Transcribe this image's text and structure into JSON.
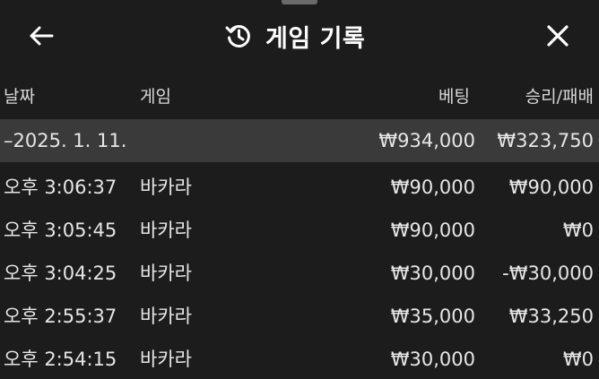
{
  "header": {
    "title": "게임 기록",
    "back_icon": "arrow-left-icon",
    "history_icon": "history-icon",
    "close_icon": "close-icon"
  },
  "columns": {
    "date": "날짜",
    "game": "게임",
    "bet": "베팅",
    "result": "승리/패배"
  },
  "summary": {
    "date": "–2025. 1. 11.",
    "game": "",
    "bet": "₩934,000",
    "result": "₩323,750"
  },
  "rows": [
    {
      "time": "오후 3:06:37",
      "game": "바카라",
      "bet": "₩90,000",
      "result": "₩90,000"
    },
    {
      "time": "오후 3:05:45",
      "game": "바카라",
      "bet": "₩90,000",
      "result": "₩0"
    },
    {
      "time": "오후 3:04:25",
      "game": "바카라",
      "bet": "₩30,000",
      "result": "-₩30,000"
    },
    {
      "time": "오후 2:55:37",
      "game": "바카라",
      "bet": "₩35,000",
      "result": "₩33,250"
    },
    {
      "time": "오후 2:54:15",
      "game": "바카라",
      "bet": "₩30,000",
      "result": "₩0"
    }
  ]
}
